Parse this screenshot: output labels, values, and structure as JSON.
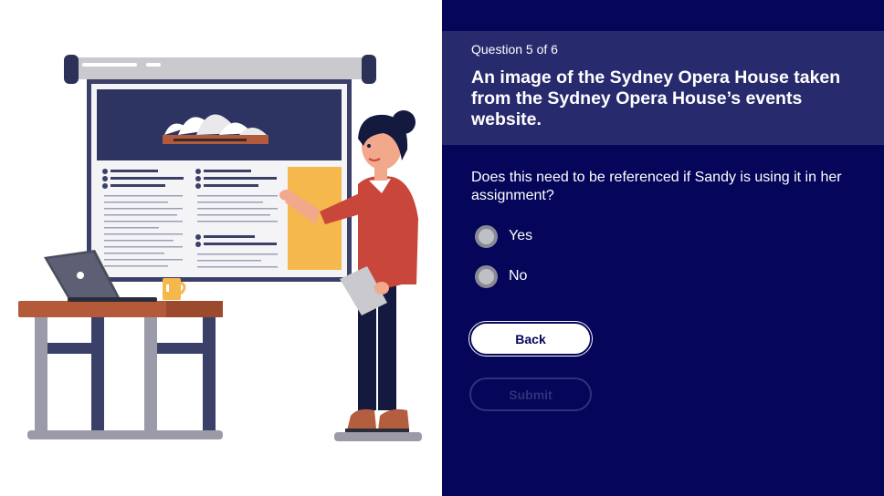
{
  "colors": {
    "panel_background": "#05055a",
    "header_band": "#282a6e",
    "radio_fill": "#bfbfc6",
    "submit_disabled": "#2f3278"
  },
  "illustration": {
    "subject": "woman presenting a poster of the Sydney Opera House beside a desk with a laptop and mug"
  },
  "question": {
    "counter": "Question 5 of 6",
    "title": "An image of the Sydney Opera House taken from the Sydney Opera House’s events website.",
    "prompt": "Does this need to be referenced if Sandy is using it in her assignment?"
  },
  "options": [
    {
      "label": "Yes",
      "selected": false
    },
    {
      "label": "No",
      "selected": false
    }
  ],
  "buttons": {
    "back": "Back",
    "submit": "Submit",
    "submit_enabled": false
  }
}
